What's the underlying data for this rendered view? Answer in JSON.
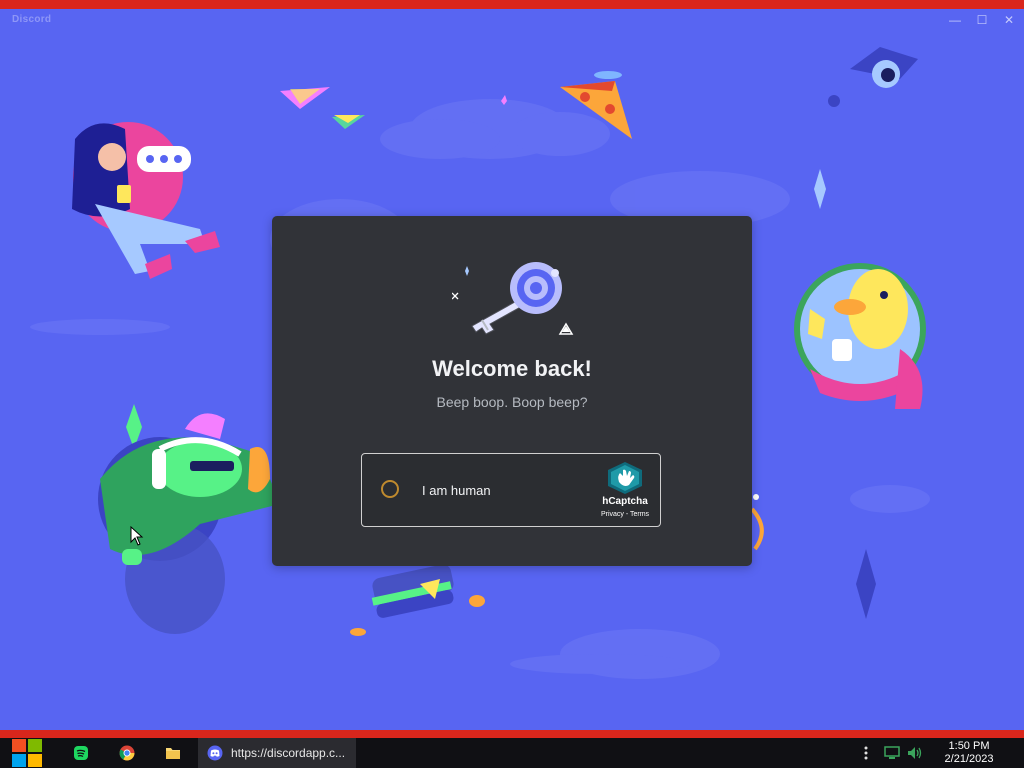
{
  "window": {
    "title": "Discord",
    "minimize_glyph": "—",
    "maximize_glyph": "☐",
    "close_glyph": "✕"
  },
  "modal": {
    "title": "Welcome back!",
    "subtitle": "Beep boop. Boop beep?",
    "hero_icon": "key-icon"
  },
  "captcha": {
    "checkbox_label": "I am human",
    "brand": "hCaptcha",
    "privacy_label": "Privacy",
    "separator": " - ",
    "terms_label": "Terms"
  },
  "taskbar": {
    "items": [
      {
        "icon": "windows-start-icon"
      },
      {
        "icon": "spotify-icon"
      },
      {
        "icon": "chrome-icon"
      },
      {
        "icon": "folder-icon"
      },
      {
        "icon": "discord-icon"
      }
    ],
    "active_window_label": "https://discordapp.c...",
    "clock_time": "1:50 PM",
    "clock_date": "2/21/2023"
  },
  "colors": {
    "background": "#5865f2",
    "modal": "#313338",
    "accent": "#5865f2",
    "captcha_checkbox": "#bf8a2e"
  }
}
